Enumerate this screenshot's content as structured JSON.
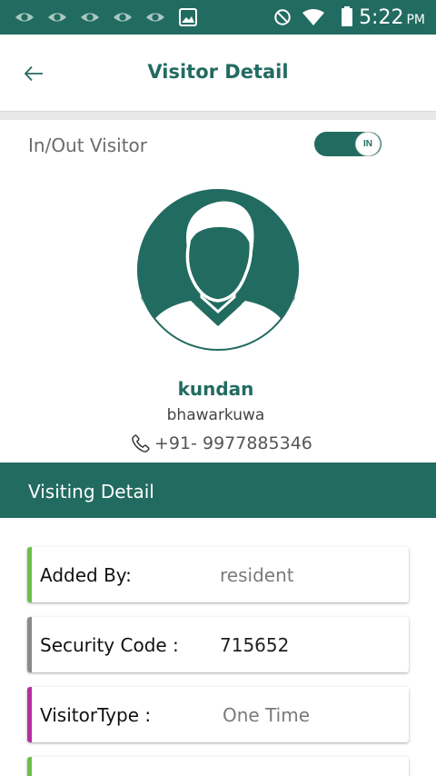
{
  "status_bar": {
    "time": "5:22",
    "ampm": "PM",
    "icons": [
      "eye-icon",
      "eye-icon",
      "eye-icon",
      "eye-icon",
      "eye-icon",
      "image-icon",
      "do-not-disturb-icon",
      "wifi-icon",
      "battery-icon"
    ]
  },
  "appbar": {
    "title": "Visitor Detail",
    "back_icon": "arrow-left-icon"
  },
  "inout": {
    "label": "In/Out Visitor",
    "toggle_text": "IN",
    "toggle_on": true
  },
  "visitor": {
    "name": "kundan",
    "place": "bhawarkuwa",
    "phone": "+91- 9977885346",
    "avatar_icon": "user-avatar-icon"
  },
  "visiting_detail": {
    "title": "Visiting Detail",
    "cards": [
      {
        "label": "Added By:",
        "value": "resident",
        "color": "#6cc04a"
      },
      {
        "label": "Security Code :",
        "value": "715652",
        "color": "#8a8a8a"
      },
      {
        "label": "VisitorType :",
        "value": "One Time",
        "color": "#b5309e"
      },
      {
        "label": "",
        "value": "",
        "color": "#6cc04a"
      }
    ]
  },
  "colors": {
    "primary": "#226b60",
    "white": "#ffffff"
  }
}
